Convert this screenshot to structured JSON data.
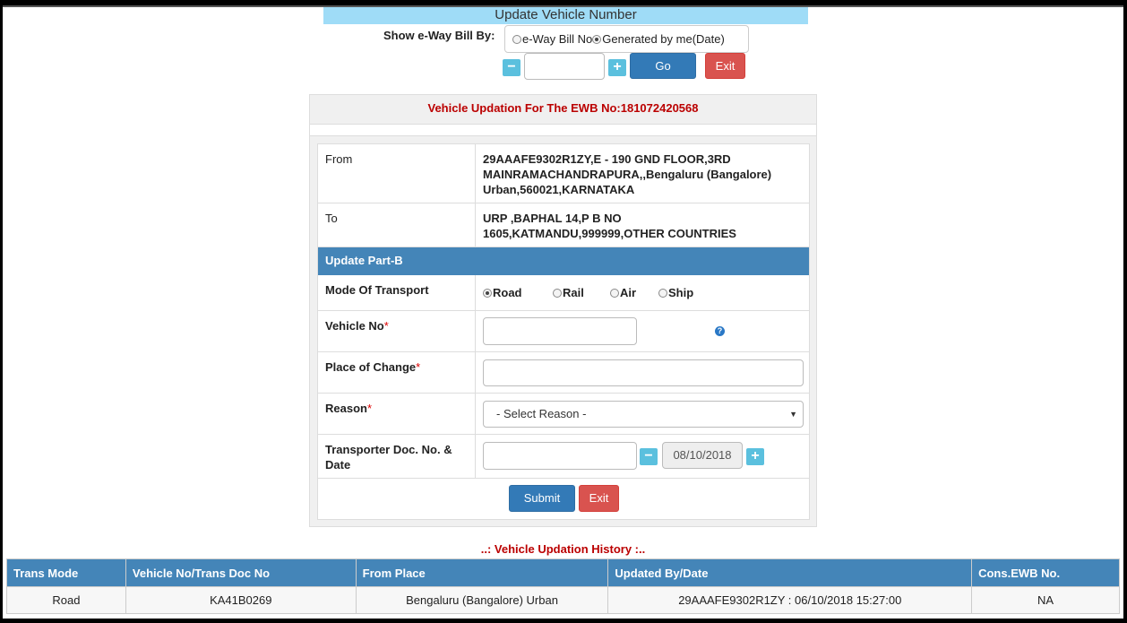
{
  "page": {
    "title": "Update Vehicle Number",
    "show_label": "Show e-Way Bill By:",
    "options": [
      {
        "label": "e-Way Bill No",
        "selected": false
      },
      {
        "label": "Generated by me(Date)",
        "selected": true
      }
    ],
    "minus": "−",
    "plus": "+",
    "date_value": "",
    "go_label": "Go",
    "exit_label": "Exit"
  },
  "panel": {
    "heading": "Vehicle Updation For The EWB No:181072420568",
    "from_label": "From",
    "from_value": "29AAAFE9302R1ZY,E - 190 GND FLOOR,3RD MAINRAMACHANDRAPURA,,Bengaluru (Bangalore) Urban,560021,KARNATAKA",
    "to_label": "To",
    "to_value": "URP ,BAPHAL 14,P B NO 1605,KATMANDU,999999,OTHER COUNTRIES",
    "section_title": "Update Part-B",
    "mode_label": "Mode Of Transport",
    "modes": [
      {
        "label": "Road",
        "selected": true
      },
      {
        "label": "Rail",
        "selected": false
      },
      {
        "label": "Air",
        "selected": false
      },
      {
        "label": "Ship",
        "selected": false
      }
    ],
    "vehicle_label": "Vehicle No",
    "vehicle_value": "",
    "help_icon": "?",
    "place_label": "Place of Change",
    "place_value": "",
    "reason_label": "Reason",
    "reason_placeholder": "- Select Reason -",
    "transporter_label": "Transporter Doc. No. & Date",
    "transporter_doc_value": "",
    "transporter_date": "08/10/2018",
    "required_mark": "*",
    "submit_label": "Submit",
    "exit_label": "Exit"
  },
  "history": {
    "title": "..: Vehicle Updation History :..",
    "columns": [
      "Trans Mode",
      "Vehicle No/Trans Doc No",
      "From Place",
      "Updated By/Date",
      "Cons.EWB No."
    ],
    "rows": [
      [
        "Road",
        "KA41B0269",
        "Bengaluru (Bangalore) Urban",
        "29AAAFE9302R1ZY : 06/10/2018 15:27:00",
        "NA"
      ]
    ]
  },
  "colors": {
    "title_bar": "#9fdcf7",
    "accent_blue": "#337ab7",
    "section_blue": "#4485b8",
    "danger_red": "#d9534f",
    "heading_red": "#bb0000"
  }
}
